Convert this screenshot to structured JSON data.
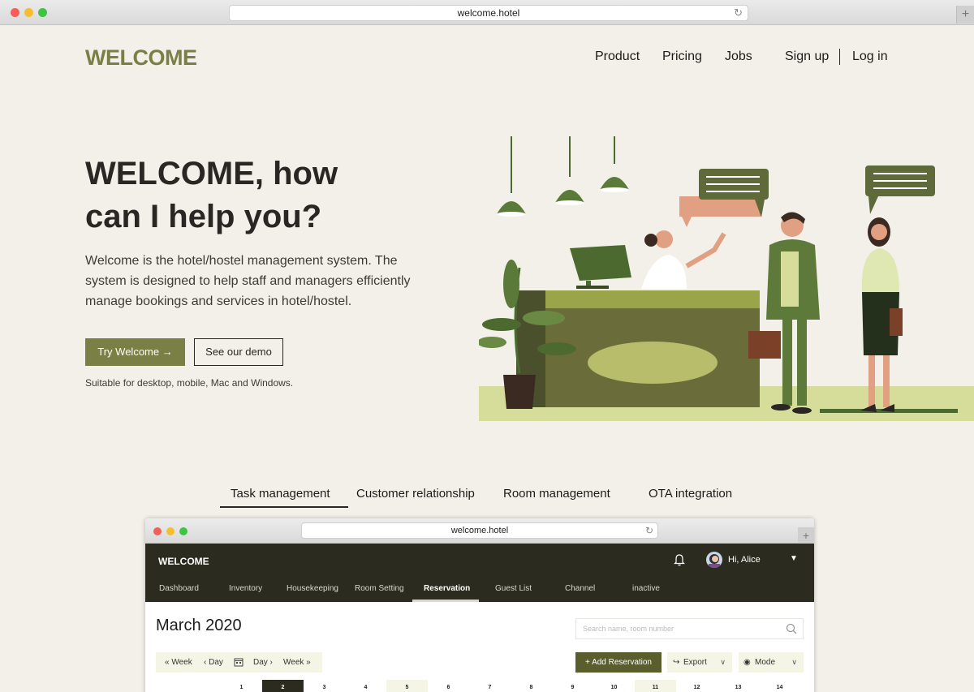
{
  "browser": {
    "url": "welcome.hotel",
    "new_tab": "+"
  },
  "header": {
    "logo": "WELCOME",
    "nav": [
      "Product",
      "Pricing",
      "Jobs"
    ],
    "signup": "Sign up",
    "login": "Log in"
  },
  "hero": {
    "title_line1": "WELCOME, how",
    "title_line2": "can I help you?",
    "description": "Welcome is the hotel/hostel management system. The system is designed to help staff and managers efficiently manage bookings and services in hotel/hostel.",
    "primary_button": "Try Welcome →",
    "secondary_button": "See our demo",
    "note": "Suitable for desktop, mobile, Mac and Windows."
  },
  "feature_tabs": [
    "Task management",
    "Customer relationship",
    "Room management",
    "OTA integration"
  ],
  "app": {
    "url": "welcome.hotel",
    "logo": "WELCOME",
    "user_greeting": "Hi, Alice",
    "tabs": [
      "Dashboard",
      "Inventory",
      "Housekeeping",
      "Room Setting",
      "Reservation",
      "Guest List",
      "Channel",
      "inactive"
    ],
    "active_tab": "Reservation",
    "month": "March 2020",
    "search_placeholder": "Search name, room number",
    "nav_controls": [
      "« Week",
      "‹ Day",
      "Day ›",
      "Week »"
    ],
    "add_button": "+ Add Reservation",
    "export_label": "Export",
    "mode_label": "Mode",
    "days": [
      "1",
      "2",
      "3",
      "4",
      "5",
      "6",
      "7",
      "8",
      "9",
      "10",
      "11",
      "12",
      "13",
      "14"
    ],
    "selected_day": "2"
  },
  "colors": {
    "olive": "#7a7f46",
    "dark_olive": "#2b2b1f",
    "background": "#f3efe9"
  }
}
